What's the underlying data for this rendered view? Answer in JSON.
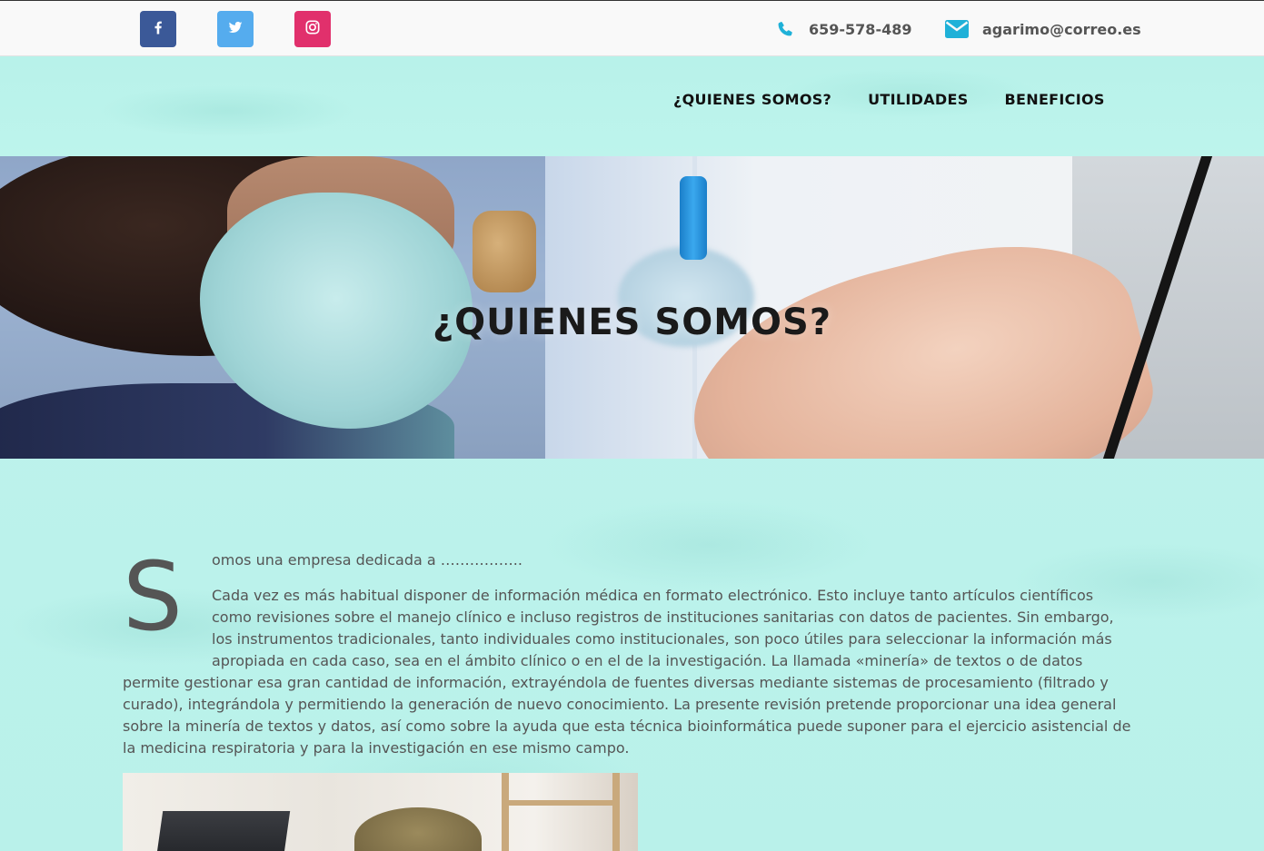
{
  "topbar": {
    "social": [
      {
        "name": "facebook",
        "icon": "facebook-icon",
        "color": "#3b5998"
      },
      {
        "name": "twitter",
        "icon": "twitter-icon",
        "color": "#55acee"
      },
      {
        "name": "instagram",
        "icon": "instagram-icon",
        "color": "#e1306c"
      }
    ],
    "phone": {
      "icon": "phone-icon",
      "text": "659-578-489",
      "color": "#1fb1d8"
    },
    "email": {
      "icon": "envelope-icon",
      "text": "agarimo@correo.es",
      "color": "#1fb1d8"
    }
  },
  "nav": {
    "items": [
      {
        "label": "¿QUIENES SOMOS?"
      },
      {
        "label": "UTILIDADES"
      },
      {
        "label": "BENEFICIOS"
      }
    ]
  },
  "hero": {
    "title": "¿QUIENES SOMOS?"
  },
  "content": {
    "dropcap": "S",
    "intro": "omos una empresa dedicada a ……………..",
    "body": "Cada vez es más habitual disponer de información médica en formato electrónico. Esto incluye tanto artículos científicos como revisiones sobre el manejo clínico e incluso registros de instituciones sanitarias con datos de pacientes. Sin embargo, los instrumentos tradicionales, tanto individuales como institucionales, son poco útiles para seleccionar la información más apropiada en cada caso, sea en el ámbito clínico o en el de la investigación. La llamada «minería» de textos o de datos permite gestionar esa gran cantidad de información, extrayéndola de fuentes diversas mediante sistemas de procesamiento (filtrado y curado), integrándola y permitiendo la generación de nuevo conocimiento. La presente revisión pretende proporcionar una idea general sobre la minería de textos y datos, así como sobre la ayuda que esta técnica bioinformática puede suponer para el ejercicio asistencial de la medicina respiratoria y para la investigación en ese mismo campo."
  },
  "colors": {
    "accent": "#1fb1d8",
    "page_background": "#bdf3ec",
    "text": "#555555"
  }
}
